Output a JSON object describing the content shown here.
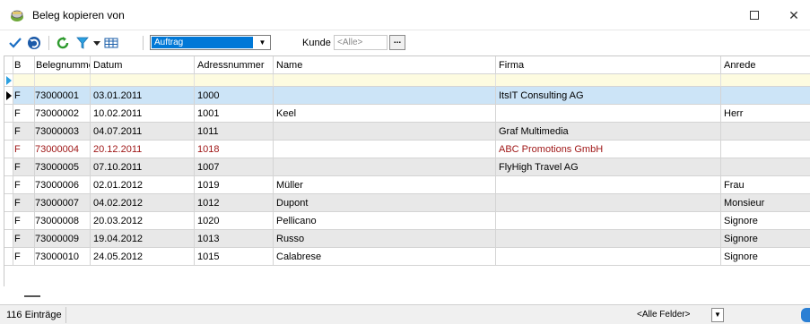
{
  "window": {
    "title": "Beleg kopieren von",
    "maximize_label": "",
    "close_label": "✕"
  },
  "toolbar": {
    "combo_value": "Auftrag",
    "kunde_label": "Kunde",
    "kunde_placeholder": "<Alle>",
    "kunde_button": "..."
  },
  "table": {
    "columns": [
      "B",
      "Belegnummer",
      "Datum",
      "Adressnummer",
      "Name",
      "Firma",
      "Anrede"
    ],
    "rows": [
      [
        "F",
        "73000001",
        "03.01.2011",
        "1000",
        "",
        "ItsIT Consulting AG",
        ""
      ],
      [
        "F",
        "73000002",
        "10.02.2011",
        "1001",
        "Keel",
        "",
        "Herr"
      ],
      [
        "F",
        "73000003",
        "04.07.2011",
        "1011",
        "",
        "Graf Multimedia",
        ""
      ],
      [
        "F",
        "73000004",
        "20.12.2011",
        "1018",
        "",
        "ABC Promotions GmbH",
        ""
      ],
      [
        "F",
        "73000005",
        "07.10.2011",
        "1007",
        "",
        "FlyHigh Travel AG",
        ""
      ],
      [
        "F",
        "73000006",
        "02.01.2012",
        "1019",
        "Müller",
        "",
        "Frau"
      ],
      [
        "F",
        "73000007",
        "04.02.2012",
        "1012",
        "Dupont",
        "",
        "Monsieur"
      ],
      [
        "F",
        "73000008",
        "20.03.2012",
        "1020",
        "Pellicano",
        "",
        "Signore"
      ],
      [
        "F",
        "73000009",
        "19.04.2012",
        "1013",
        "Russo",
        "",
        "Signore"
      ],
      [
        "F",
        "73000010",
        "24.05.2012",
        "1015",
        "Calabrese",
        "",
        "Signore"
      ]
    ]
  },
  "status": {
    "count": "116 Einträge",
    "field_filter": "<Alle Felder>"
  },
  "colors": {
    "selected_row": "#cce4f7",
    "alt_row": "#e8e8e8",
    "highlight_text": "#a01818",
    "filter_row": "#fdfbe0",
    "accent": "#0078d7"
  }
}
